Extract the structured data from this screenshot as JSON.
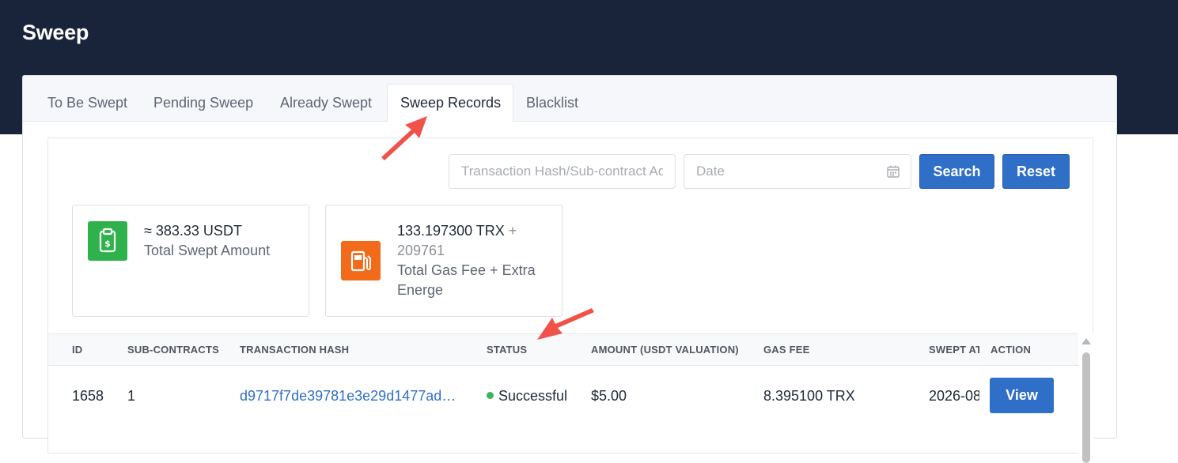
{
  "page": {
    "title": "Sweep"
  },
  "tabs": [
    {
      "label": "To Be Swept",
      "active": false
    },
    {
      "label": "Pending Sweep",
      "active": false
    },
    {
      "label": "Already Swept",
      "active": false
    },
    {
      "label": "Sweep Records",
      "active": true
    },
    {
      "label": "Blacklist",
      "active": false
    }
  ],
  "filters": {
    "hash_placeholder": "Transaction Hash/Sub-contract Address",
    "date_placeholder": "Date",
    "search_label": "Search",
    "reset_label": "Reset"
  },
  "stats": {
    "swept": {
      "value": "≈ 383.33 USDT",
      "label": "Total Swept Amount",
      "icon": "clipboard-dollar-icon",
      "color": "#2fb24c"
    },
    "gas": {
      "value": "133.197300 TRX",
      "plus": " + ",
      "extra": "209761",
      "label": "Total Gas Fee + Extra Energe",
      "icon": "gas-pump-icon",
      "color": "#f26b1a"
    }
  },
  "table": {
    "columns": [
      "ID",
      "SUB-CONTRACTS",
      "TRANSACTION HASH",
      "STATUS",
      "AMOUNT (USDT VALUATION)",
      "GAS FEE",
      "SWEPT AT",
      "ACTION"
    ],
    "rows": [
      {
        "id": "1658",
        "sub_contracts": "1",
        "tx_hash": "d9717f7de39781e3e29d1477ad…",
        "status": "Successful",
        "amount": "$5.00",
        "gas_fee": "8.395100 TRX",
        "swept_at": "2026-08",
        "action": "View"
      }
    ]
  },
  "colors": {
    "topbar": "#19243a",
    "primary": "#2f6fc7",
    "success": "#3bb55a",
    "annotation": "#f0524a"
  }
}
